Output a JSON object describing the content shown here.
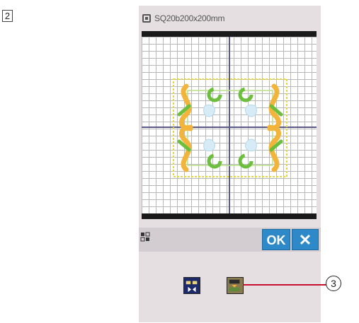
{
  "step_number": "2",
  "screen": {
    "hoop_icon": "hoop-icon",
    "hoop_label": "SQ20b200x200mm"
  },
  "toolbar": {
    "rotate_icon": "rotate-icon",
    "ok_label": "OK",
    "close_label": "✕"
  },
  "mode_buttons": [
    {
      "icon": "mirror-horizontal-icon"
    },
    {
      "icon": "mirror-vertical-icon"
    }
  ],
  "callout": {
    "number": "3"
  },
  "colors": {
    "accent_blue": "#2e89c8",
    "callout_red": "#c8102e",
    "frame_black": "#1a1a1a",
    "panel_bg": "#e6dfe2"
  }
}
